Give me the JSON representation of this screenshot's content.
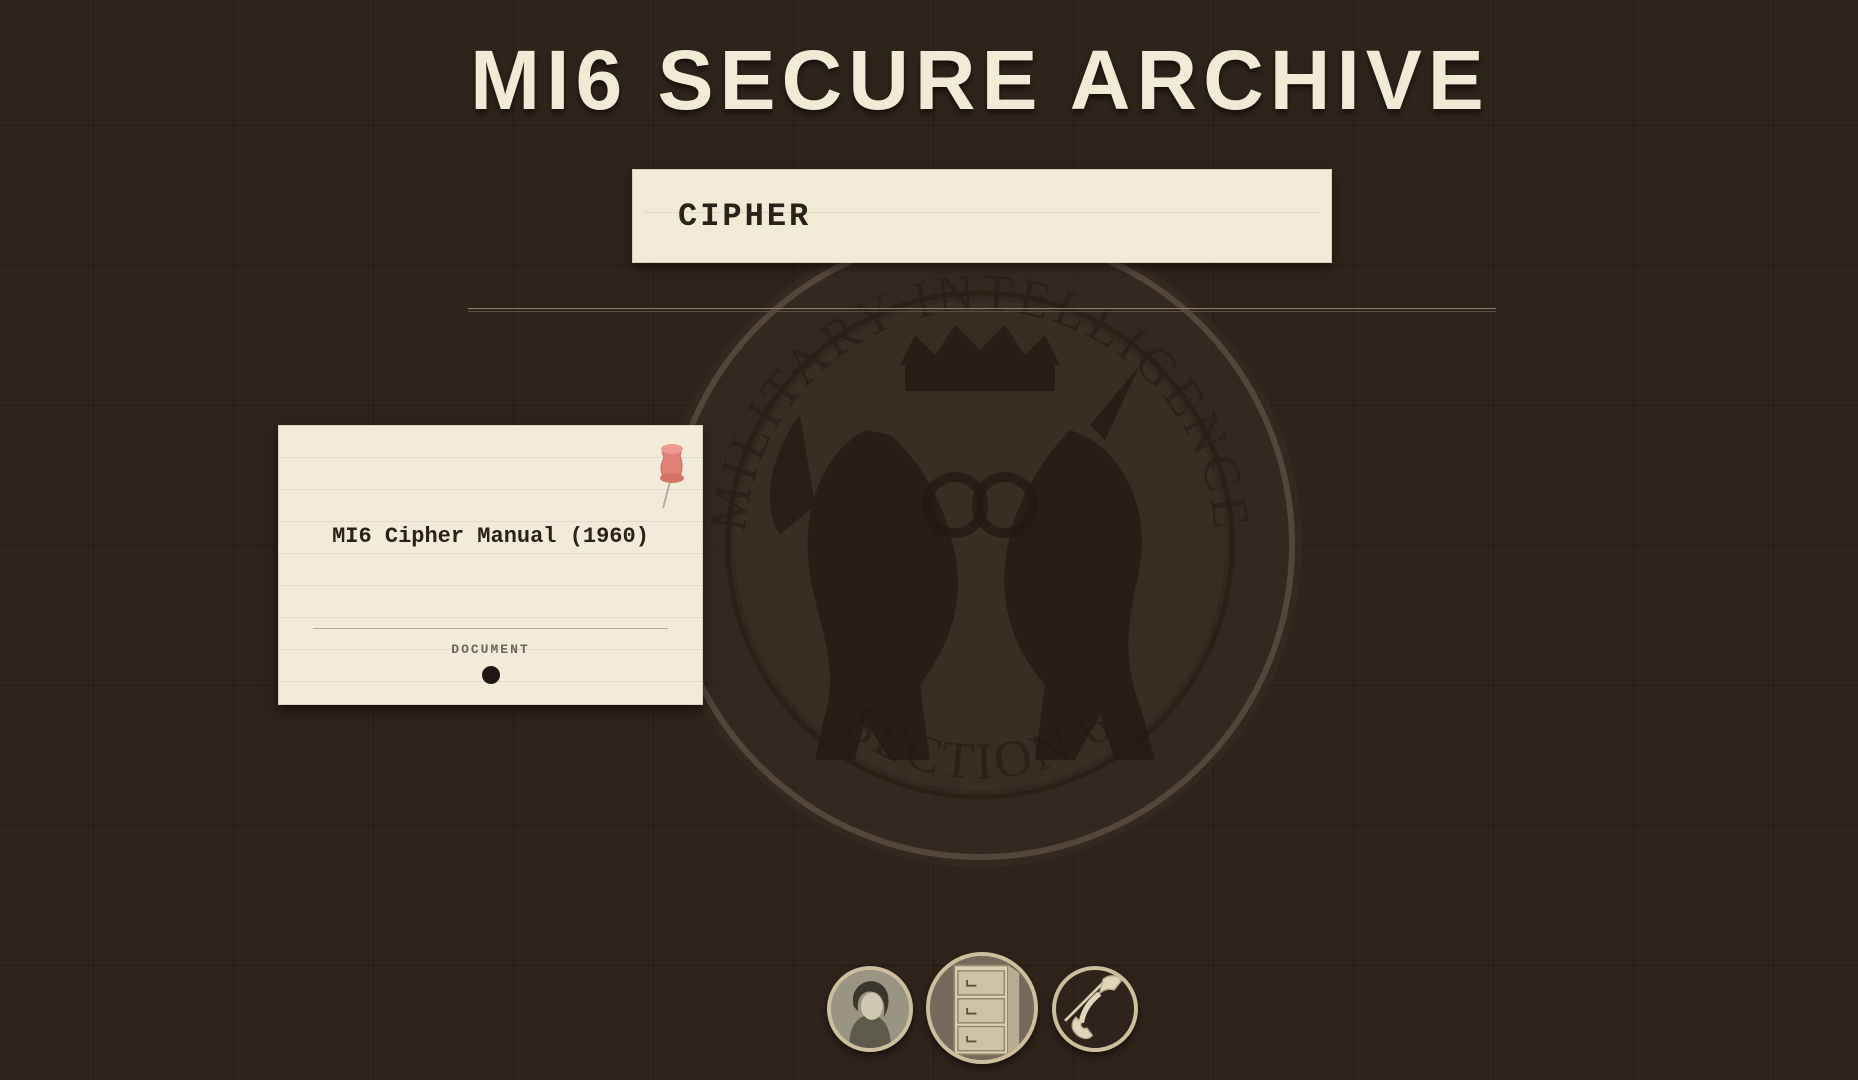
{
  "app": {
    "title": "MI6 SECURE ARCHIVE"
  },
  "search": {
    "value": "CIPHER",
    "placeholder": ""
  },
  "emblem": {
    "top_text": "MILITARY INTELLIGENCE",
    "bottom_text": "SECTION 6"
  },
  "results": [
    {
      "title": "MI6 Cipher Manual (1960)",
      "type": "DOCUMENT"
    }
  ],
  "nav": {
    "items": [
      "profile-icon",
      "filing-cabinet-icon",
      "telephone-icon"
    ]
  },
  "colors": {
    "background": "#2e241b",
    "paper": "#f2ebda",
    "title": "#f1ead6",
    "pin": "#e08278"
  }
}
